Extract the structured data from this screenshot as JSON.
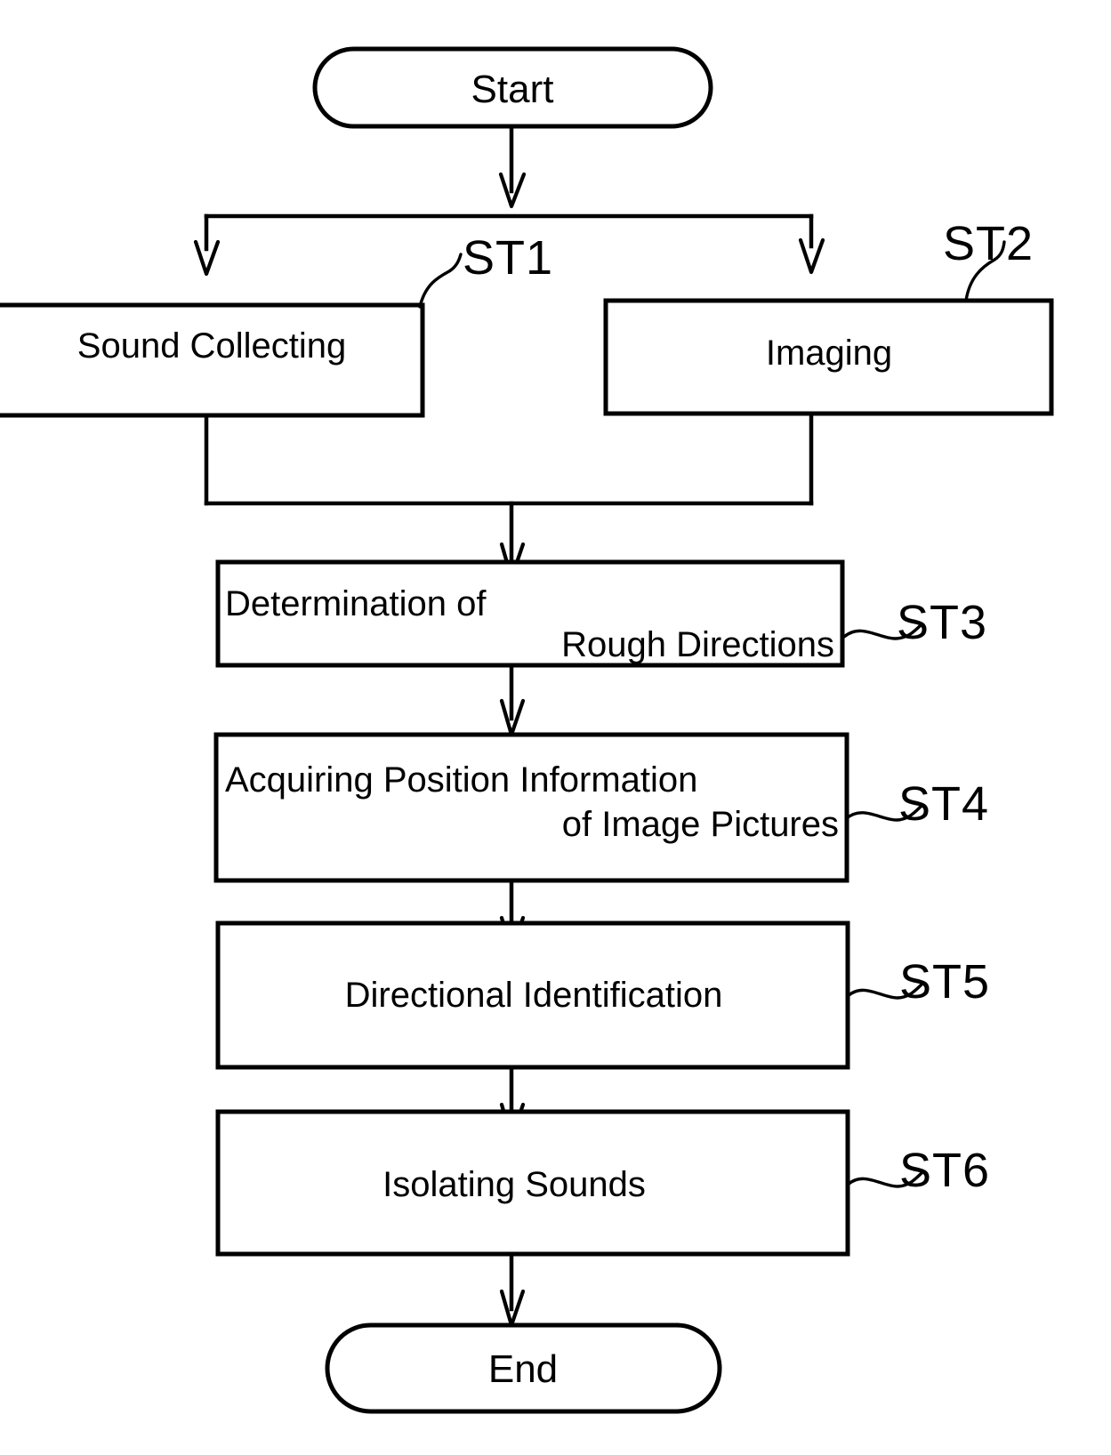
{
  "diagram": {
    "type": "flowchart",
    "title": "Sound isolation process flowchart",
    "orientation": "top-to-bottom",
    "line_color": "#000000",
    "fill_color": "#ffffff",
    "background": "#ffffff"
  },
  "nodes": {
    "start": {
      "label": "Start",
      "shape": "stadium"
    },
    "st1": {
      "label": "Sound Collecting",
      "ref": "ST1",
      "shape": "rectangle"
    },
    "st2": {
      "label": "Imaging",
      "ref": "ST2",
      "shape": "rectangle"
    },
    "st3": {
      "label_line1": "Determination of",
      "label_line2": "Rough Directions",
      "ref": "ST3",
      "shape": "rectangle"
    },
    "st4": {
      "label_line1": "Acquiring Position Information",
      "label_line2": "of Image Pictures",
      "ref": "ST4",
      "shape": "rectangle"
    },
    "st5": {
      "label": "Directional Identification",
      "ref": "ST5",
      "shape": "rectangle"
    },
    "st6": {
      "label": "Isolating Sounds",
      "ref": "ST6",
      "shape": "rectangle"
    },
    "end": {
      "label": "End",
      "shape": "stadium"
    }
  },
  "edges": [
    {
      "from": "start",
      "to": "fork",
      "style": "arrow"
    },
    {
      "from": "fork",
      "to": "st1",
      "style": "arrow"
    },
    {
      "from": "fork",
      "to": "st2",
      "style": "arrow"
    },
    {
      "from": "st1",
      "to": "merge",
      "style": "line"
    },
    {
      "from": "st2",
      "to": "merge",
      "style": "line"
    },
    {
      "from": "merge",
      "to": "st3",
      "style": "arrow"
    },
    {
      "from": "st3",
      "to": "st4",
      "style": "arrow"
    },
    {
      "from": "st4",
      "to": "st5",
      "style": "arrow"
    },
    {
      "from": "st5",
      "to": "st6",
      "style": "arrow"
    },
    {
      "from": "st6",
      "to": "end",
      "style": "arrow"
    }
  ]
}
